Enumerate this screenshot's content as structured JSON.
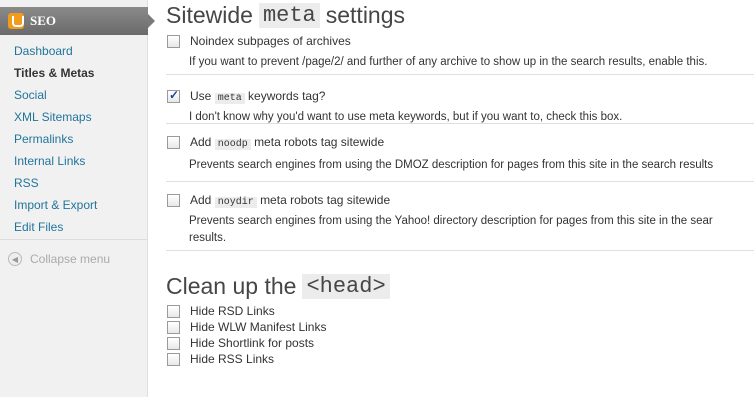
{
  "sidebar": {
    "title": "SEO",
    "items": [
      {
        "label": "Dashboard"
      },
      {
        "label": "Titles & Metas"
      },
      {
        "label": "Social"
      },
      {
        "label": "XML Sitemaps"
      },
      {
        "label": "Permalinks"
      },
      {
        "label": "Internal Links"
      },
      {
        "label": "RSS"
      },
      {
        "label": "Import & Export"
      },
      {
        "label": "Edit Files"
      }
    ],
    "current": "Titles & Metas",
    "collapse_label": "Collapse menu"
  },
  "sitewide": {
    "heading_pre": "Sitewide",
    "heading_code": "meta",
    "heading_post": "settings",
    "settings": [
      {
        "label": "Noindex subpages of archives",
        "checked": false,
        "description": "If you want to prevent /page/2/ and further of any archive to show up in the search results, enable this."
      },
      {
        "label_pre": "Use",
        "label_code": "meta",
        "label_post": "keywords tag?",
        "checked": true,
        "description": "I don't know why you'd want to use meta keywords, but if you want to, check this box."
      },
      {
        "label_pre": "Add",
        "label_code": "noodp",
        "label_post": "meta robots tag sitewide",
        "checked": false,
        "description": "Prevents search engines from using the DMOZ description for pages from this site in the search results"
      },
      {
        "label_pre": "Add",
        "label_code": "noydir",
        "label_post": "meta robots tag sitewide",
        "checked": false,
        "description": "Prevents search engines from using the Yahoo! directory description for pages from this site in the sear",
        "description2": "results."
      }
    ]
  },
  "cleanup": {
    "heading_pre": "Clean up the",
    "heading_code": "<head>",
    "options": [
      {
        "label": "Hide RSD Links",
        "checked": false
      },
      {
        "label": "Hide WLW Manifest Links",
        "checked": false
      },
      {
        "label": "Hide Shortlink for posts",
        "checked": false
      },
      {
        "label": "Hide RSS Links",
        "checked": false
      }
    ]
  },
  "colors": {
    "link": "#21759b",
    "menu_head": "#787878",
    "logo": "#f29b1c"
  }
}
